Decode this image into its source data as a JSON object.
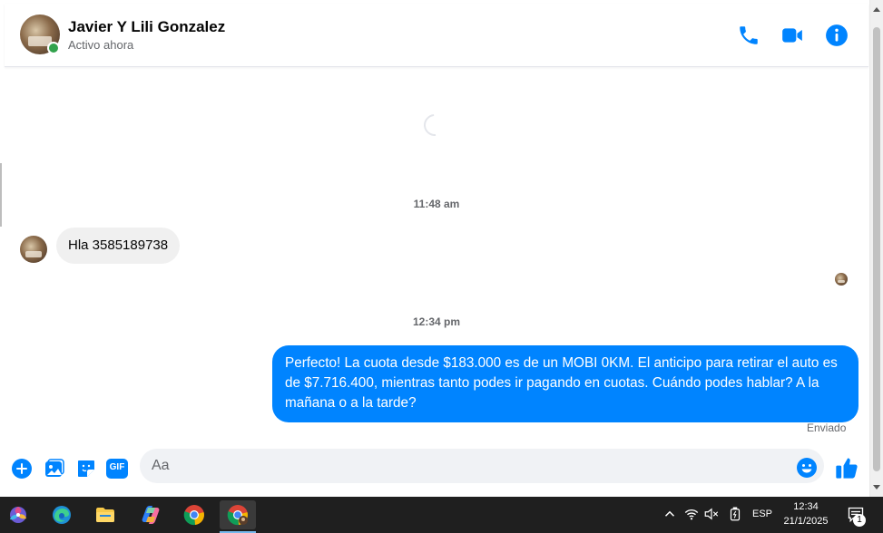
{
  "header": {
    "name": "Javier Y Lili Gonzalez",
    "status": "Activo ahora",
    "icons": [
      "phone-icon",
      "video-camera-icon",
      "info-icon"
    ]
  },
  "messages": {
    "time_1": "11:48 am",
    "incoming_text": "Hla 3585189738",
    "time_2": "12:34 pm",
    "outgoing_text": "Perfecto! La cuota desde $183.000 es de un MOBI 0KM. El anticipo para retirar el auto es de $7.716.400, mientras tanto podes ir pagando en cuotas. Cuándo podes hablar? A la mañana o a la tarde?",
    "sent_label": "Enviado"
  },
  "composer": {
    "placeholder": "Aa",
    "icons": [
      "plus-icon",
      "photo-icon",
      "sticker-icon",
      "gif-icon",
      "emoji-icon",
      "thumbs-up-icon"
    ],
    "gif_label": "GIF"
  },
  "taskbar": {
    "language": "ESP",
    "time": "12:34",
    "date": "21/1/2025",
    "notification_count": "1"
  },
  "colors": {
    "accent": "#0084ff",
    "online": "#31a24c",
    "incoming_bubble": "#f0f0f0",
    "taskbar": "#1f1f1f"
  }
}
